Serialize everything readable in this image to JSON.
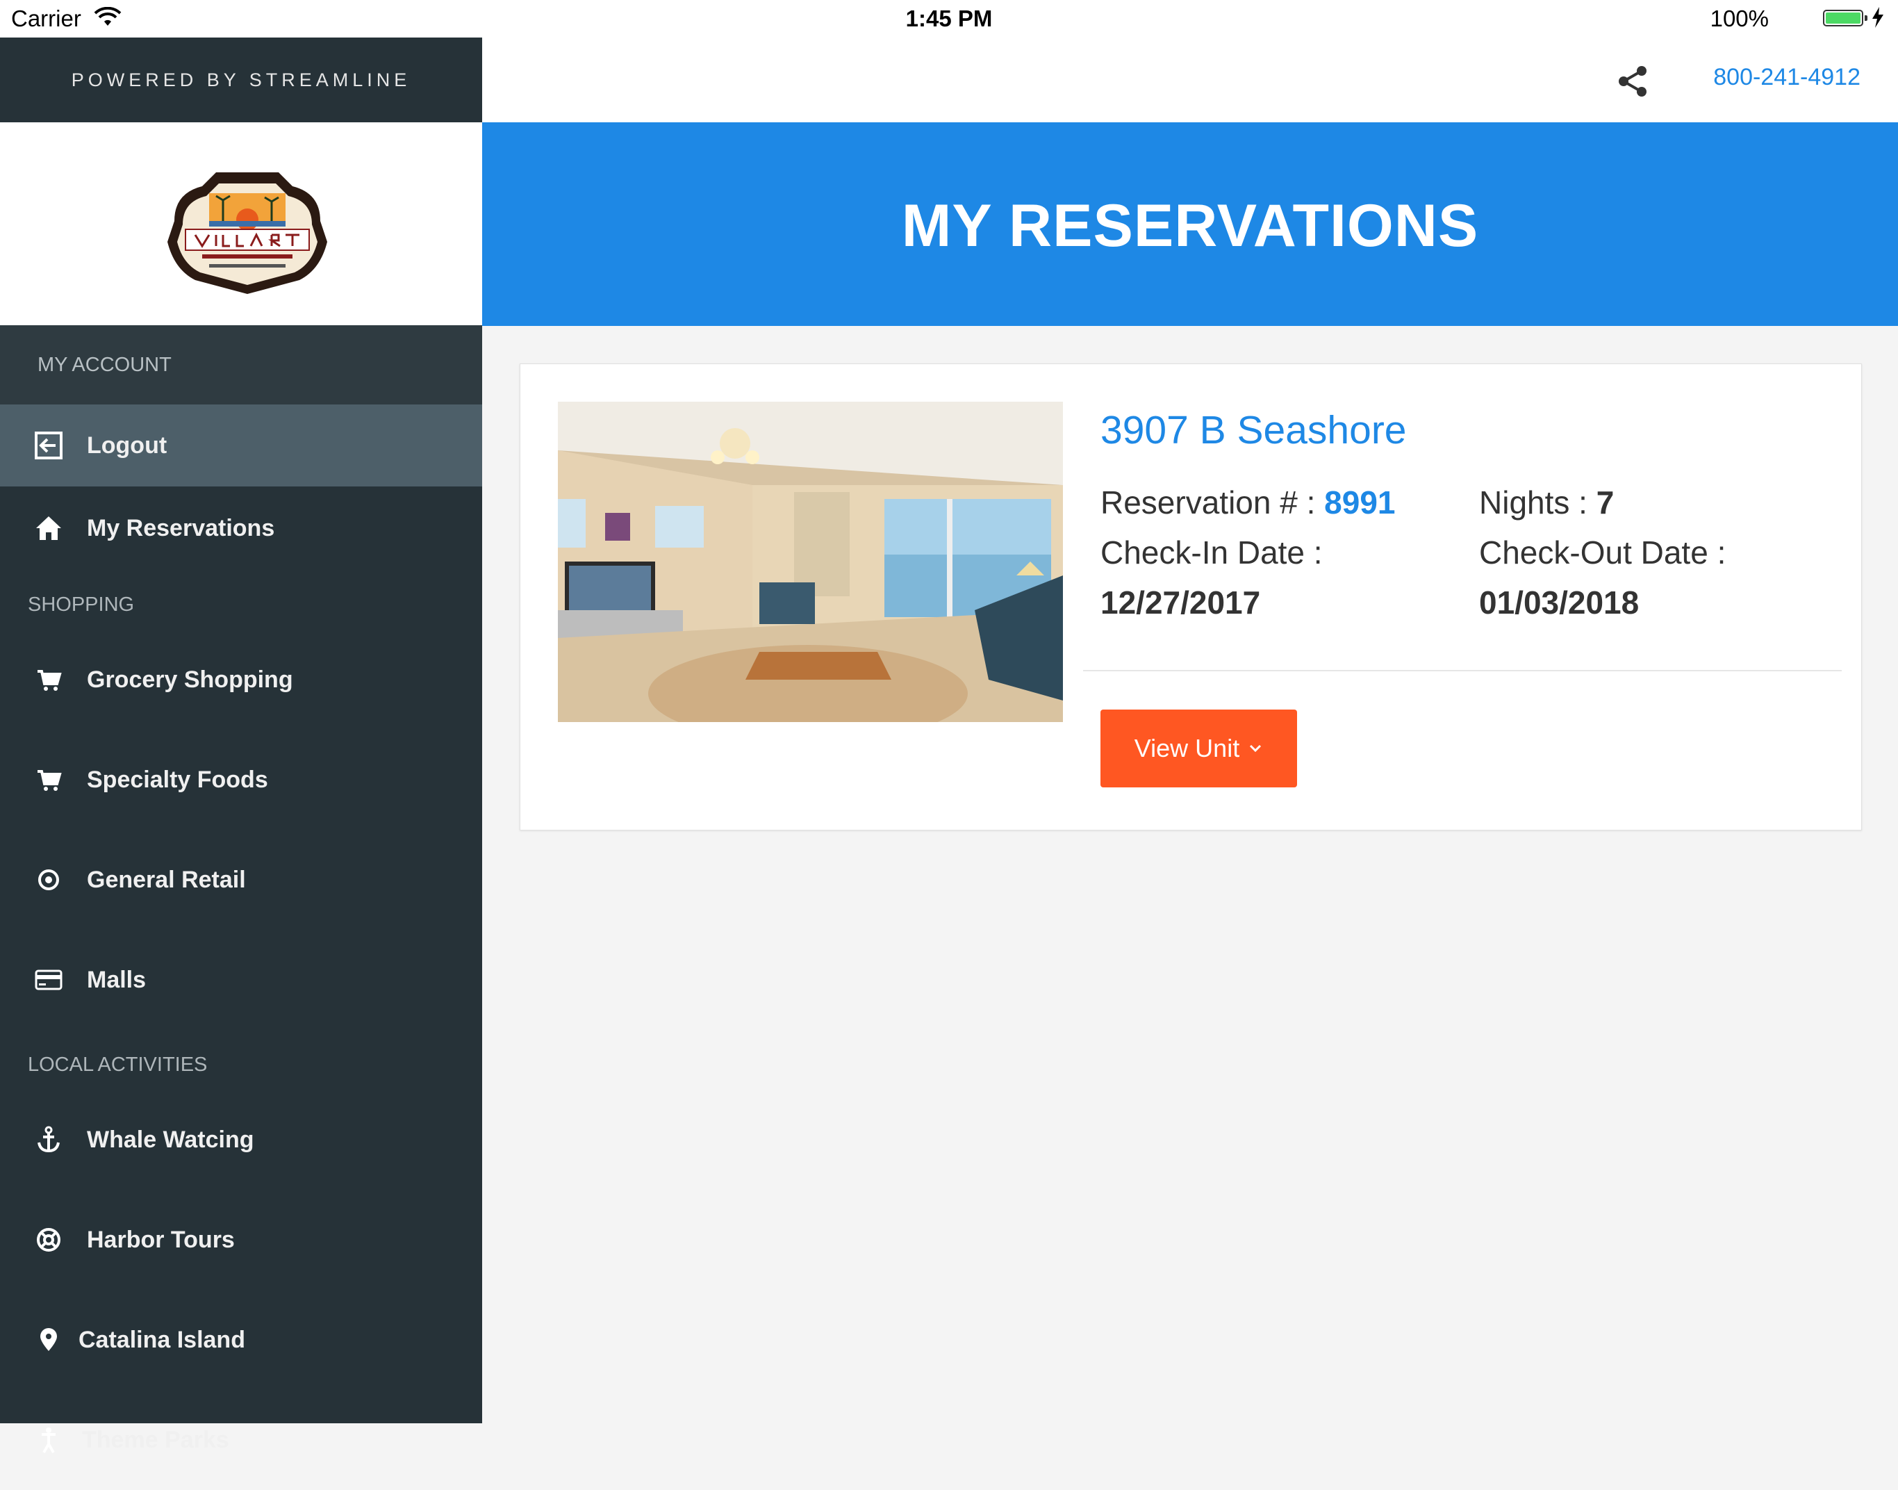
{
  "status_bar": {
    "carrier": "Carrier",
    "time": "1:45 PM",
    "battery": "100%"
  },
  "sidebar": {
    "powered_by": "POWERED BY STREAMLINE",
    "account_section": "MY ACCOUNT",
    "items_account": [
      {
        "label": "Logout",
        "icon": "logout-icon"
      },
      {
        "label": "My Reservations",
        "icon": "home-icon"
      }
    ],
    "shopping_section": "SHOPPING",
    "items_shopping": [
      {
        "label": "Grocery Shopping",
        "icon": "cart-icon"
      },
      {
        "label": "Specialty Foods",
        "icon": "cart-icon"
      },
      {
        "label": "General Retail",
        "icon": "target-icon"
      },
      {
        "label": "Malls",
        "icon": "credit-card-icon"
      }
    ],
    "activities_section": "LOCAL ACTIVITIES",
    "items_activities": [
      {
        "label": "Whale Watcing",
        "icon": "anchor-icon"
      },
      {
        "label": "Harbor Tours",
        "icon": "lifebuoy-icon"
      },
      {
        "label": "Catalina Island",
        "icon": "map-pin-icon"
      },
      {
        "label": "Theme Parks",
        "icon": "person-icon"
      }
    ]
  },
  "header": {
    "phone": "800-241-4912",
    "title": "MY RESERVATIONS"
  },
  "reservation": {
    "unit_name": "3907 B Seashore",
    "reservation_label": "Reservation # : ",
    "reservation_number": "8991",
    "nights_label": "Nights : ",
    "nights": "7",
    "checkin_label": "Check-In Date :",
    "checkin_date": "12/27/2017",
    "checkout_label": "Check-Out Date :",
    "checkout_date": "01/03/2018",
    "view_button": "View Unit"
  },
  "colors": {
    "primary": "#1e88e5",
    "accent": "#ff5722",
    "sidebar": "#263238"
  }
}
